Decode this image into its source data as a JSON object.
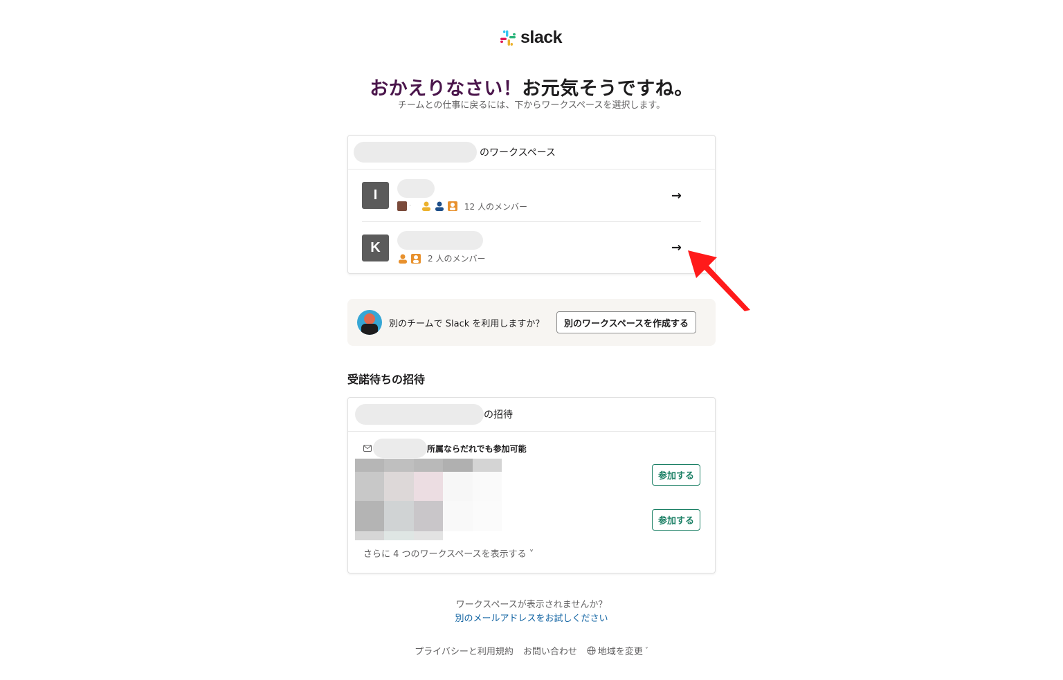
{
  "brand": {
    "logo_text": "slack",
    "logo_icon": "slack-hash-icon"
  },
  "headline": {
    "part1": "おかえりなさい！",
    "part2": "お元気そうですね。"
  },
  "subhead": "チームとの仕事に戻るには、下からワークスペースを選択します。",
  "workspaces": {
    "header_suffix": "のワークスペース",
    "items": [
      {
        "initial": "I",
        "members": "12 人のメンバー",
        "arrow": "→"
      },
      {
        "initial": "K",
        "members": "2 人のメンバー",
        "arrow": "→"
      }
    ]
  },
  "promo": {
    "question": "別のチームで Slack を利用しますか？",
    "button": "別のワークスペースを作成する"
  },
  "invites": {
    "title": "受諾待ちの招待",
    "header_suffix": "の招待",
    "note": "所属ならだれでも参加可能",
    "join_label": "参加する",
    "more": "さらに 4 つのワークスペースを表示する ˅"
  },
  "footer": {
    "question": "ワークスペースが表示されませんか？",
    "link": "別のメールアドレスをお試しください",
    "privacy": "プライバシーと利用規約",
    "contact": "お問い合わせ",
    "region": "地域を変更"
  },
  "colors": {
    "accent": "#4a154b",
    "join": "#1a7f64",
    "link": "#1264a3",
    "annotation": "#ff1a1a"
  }
}
